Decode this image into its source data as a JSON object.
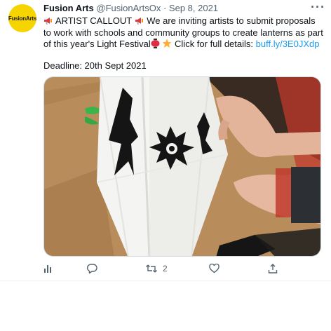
{
  "tweet": {
    "avatar_text": "FusionArts",
    "author_name": "Fusion Arts",
    "handle": "@FusionArtsOx",
    "separator": "·",
    "date": "Sep 8, 2021",
    "more": "···",
    "line1": "ARTIST CALLOUT",
    "line1_rest": "We are inviting artists to submit proposals to work with schools and community groups to create lanterns as part of this year's Light Festival",
    "line1_tail": "Click for full details:",
    "link": "buff.ly/3E0JXdp",
    "deadline": "Deadline: 20th Sept 2021"
  },
  "actions": {
    "analytics_icon": "analytics-icon",
    "reply_icon": "reply-icon",
    "retweet_icon": "retweet-icon",
    "retweet_count": "2",
    "like_icon": "heart-icon",
    "share_icon": "share-icon"
  },
  "colors": {
    "link": "#1d9bf0",
    "avatar_bg": "#f5d400",
    "muted": "#536471"
  }
}
